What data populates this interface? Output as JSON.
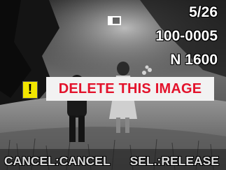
{
  "status": {
    "image_counter": "5/26",
    "folder_file": "100-0005",
    "quality": "N 1600",
    "frame_icon": "single-frame-icon"
  },
  "dialog": {
    "icon": "exclamation-icon",
    "icon_glyph": "!",
    "message": "DELETE THIS IMAGE",
    "message_color": "#e3122b",
    "icon_color": "#f2e600"
  },
  "softkeys": {
    "left": "CANCEL:CANCEL",
    "right": "SEL.:RELEASE"
  }
}
